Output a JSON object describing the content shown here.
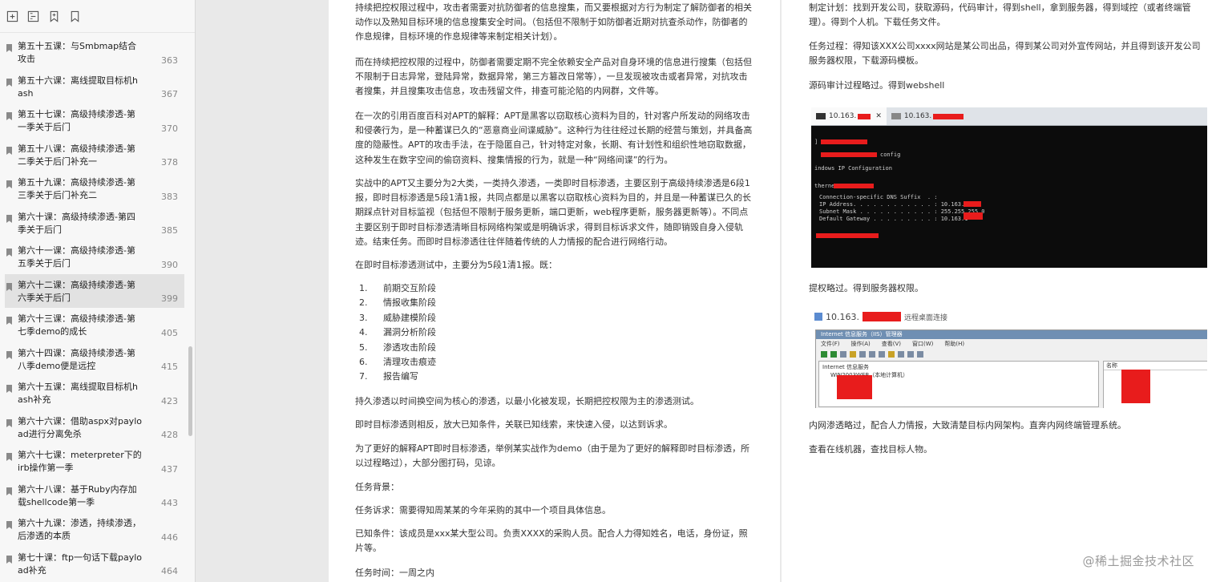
{
  "toolbar": {
    "icons": [
      "expand-outline-icon",
      "collapse-outline-icon",
      "add-bookmark-icon",
      "bookmark-icon"
    ]
  },
  "toc": [
    {
      "title": "第五十五课：与Smbmap结合攻击",
      "page": "363"
    },
    {
      "title": "第五十六课：离线提取目标机hash",
      "page": "367"
    },
    {
      "title": "第五十七课：高级持续渗透-第一季关于后门",
      "page": "370"
    },
    {
      "title": "第五十八课：高级持续渗透-第二季关于后门补充一",
      "page": "378"
    },
    {
      "title": "第五十九课：高级持续渗透-第三季关于后门补充二",
      "page": "383"
    },
    {
      "title": "第六十课：高级持续渗透-第四季关于后门",
      "page": "385"
    },
    {
      "title": "第六十一课：高级持续渗透-第五季关于后门",
      "page": "390"
    },
    {
      "title": "第六十二课：高级持续渗透-第六季关于后门",
      "page": "399"
    },
    {
      "title": "第六十三课：高级持续渗透-第七季demo的成长",
      "page": "405"
    },
    {
      "title": "第六十四课：高级持续渗透-第八季demo便是远控",
      "page": "415"
    },
    {
      "title": "第六十五课：离线提取目标机hash补充",
      "page": "423"
    },
    {
      "title": "第六十六课：借助aspx对payload进行分离免杀",
      "page": "428"
    },
    {
      "title": "第六十七课：meterpreter下的irb操作第一季",
      "page": "437"
    },
    {
      "title": "第六十八课：基于Ruby内存加载shellcode第一季",
      "page": "443"
    },
    {
      "title": "第六十九课：渗透，持续渗透，后渗透的本质",
      "page": "446"
    },
    {
      "title": "第七十课：ftp一句话下载payload补充",
      "page": "464"
    }
  ],
  "toc_selected_index": 7,
  "left_page": {
    "p1": "持续把控权限过程中，攻击者需要对抗防御者的信息搜集，而又要根据对方行为制定了解防御者的相关动作以及熟知目标环境的信息搜集安全时间。（包括但不限制于如防御者近期对抗查杀动作，防御者的作息规律，目标环境的作息规律等来制定相关计划）。",
    "p2": "而在持续把控权限的过程中，防御者需要定期不完全依赖安全产品对自身环境的信息进行搜集（包括但不限制于日志异常，登陆异常，数据异常，第三方篡改日常等），一旦发现被攻击或者异常，对抗攻击者搜集，并且搜集攻击信息，攻击残留文件，排查可能沦陷的内网群，文件等。",
    "p3": "在一次的引用百度百科对APT的解释：APT是黑客以窃取核心资料为目的，针对客户所发动的网络攻击和侵袭行为，是一种蓄谋已久的“恶意商业间谍威胁”。这种行为往往经过长期的经营与策划，并具备高度的隐蔽性。APT的攻击手法，在于隐匿自己，针对特定对象，长期、有计划性和组织性地窃取数据，这种发生在数字空间的偷窃资料、搜集情报的行为，就是一种“网络间谍”的行为。",
    "p4": "实战中的APT又主要分为2大类，一类持久渗透，一类即时目标渗透，主要区别于高级持续渗透是6段1报，即时目标渗透是5段1清1报，共同点都是以黑客以窃取核心资料为目的，并且是一种蓄谋已久的长期踩点针对目标监视（包括但不限制于服务更新，端口更新，web程序更新，服务器更新等）。不同点主要区别于即时目标渗透清晰目标网络构架或是明确诉求，得到目标诉求文件，随即销毁自身入侵轨迹。结束任务。而即时目标渗透往往伴随着传统的人力情报的配合进行网络行动。",
    "p5": "在即时目标渗透测试中，主要分为5段1清1报。既：",
    "list": [
      "前期交互阶段",
      "情报收集阶段",
      "威胁建模阶段",
      "漏洞分析阶段",
      "渗透攻击阶段",
      "清理攻击痕迹",
      "报告编写"
    ],
    "p6": "持久渗透以时间换空间为核心的渗透，以最小化被发现，长期把控权限为主的渗透测试。",
    "p7": "即时目标渗透则相反，放大已知条件，关联已知线索，来快速入侵，以达到诉求。",
    "p8": "为了更好的解释APT即时目标渗透，举例某实战作为demo（由于是为了更好的解释即时目标渗透，所以过程略过），大部分图打码，见谅。",
    "p9": "任务背景：",
    "p10": "任务诉求：需要得知周某某的今年采购的其中一个项目具体信息。",
    "p11": "已知条件：该成员是xxx某大型公司。负责XXXX的采购人员。配合人力得知姓名，电话，身份证，照片等。",
    "p12": "任务时间：一周之内"
  },
  "right_page": {
    "p1": "制定计划：找到开发公司，获取源码，代码审计，得到shell，拿到服务器，得到域控（或者终端管理）。得到个人机。下载任务文件。",
    "p2": "任务过程：得知该XXX公司xxxx网站是某公司出品，得到某公司对外宣传网站，并且得到该开发公司服务器权限，下载源码模板。",
    "p3": "源码审计过程略过。得到webshell",
    "screenshot1": {
      "tab1": "10.163.",
      "tab2": "10.163.",
      "lines": [
        "config",
        "indows IP Configuration",
        "therne",
        "Connection-specific DNS Suffix  . :",
        "IP Address. . . . . . . . . . . . : 10.163.1",
        "Subnet Mask . . . . . . . . . . . : 255.255.255.0",
        "Default Gateway . . . . . . . . . : 10.163.1"
      ]
    },
    "p4": "提权略过。得到服务器权限。",
    "screenshot2": {
      "host": "10.163.",
      "caption": "远程桌面连接",
      "window_title": "Internet 信息服务（IIS）管理器",
      "menu": [
        "文件(F)",
        "操作(A)",
        "查看(V)",
        "窗口(W)",
        "帮助(H)"
      ],
      "tree_root": "Internet 信息服务",
      "tree_child": "WIN2003WEB（本地计算机）",
      "col_header": "名称"
    },
    "p5": "内网渗透略过，配合人力情报，大致清楚目标内网架构。直奔内网终端管理系统。",
    "p6": "查看在线机器，查找目标人物。"
  },
  "watermark": "@稀土掘金技术社区",
  "colors": {
    "redact": "#e81c1c",
    "selected_bg": "#e2e2e2",
    "terminal_bg": "#0c0c0c"
  }
}
